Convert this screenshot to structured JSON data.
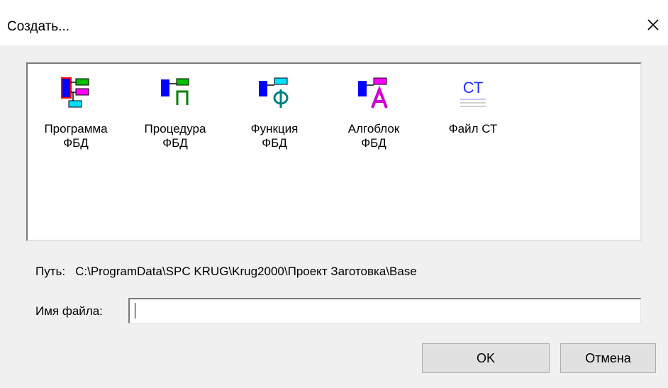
{
  "window": {
    "title": "Создать...",
    "close_icon": "close-icon"
  },
  "items": [
    {
      "label": "Программа\nФБД",
      "icon": "fbd-program-icon"
    },
    {
      "label": "Процедура\nФБД",
      "icon": "fbd-procedure-icon"
    },
    {
      "label": "Функция\nФБД",
      "icon": "fbd-function-icon"
    },
    {
      "label": "Алгоблок\nФБД",
      "icon": "fbd-algoblock-icon"
    },
    {
      "label": "Файл СТ",
      "icon": "st-file-icon",
      "icon_text": "СТ"
    }
  ],
  "path": {
    "label": "Путь:",
    "value": "C:\\ProgramData\\SPC KRUG\\Krug2000\\Проект Заготовка\\Base"
  },
  "filename": {
    "label": "Имя файла:",
    "value": ""
  },
  "buttons": {
    "ok": "OK",
    "cancel": "Отмена"
  },
  "colors": {
    "blue": "#0000ff",
    "green": "#00c000",
    "cyan": "#00e0ff",
    "magenta": "#ff00ff",
    "selection_red": "#ff0000"
  }
}
